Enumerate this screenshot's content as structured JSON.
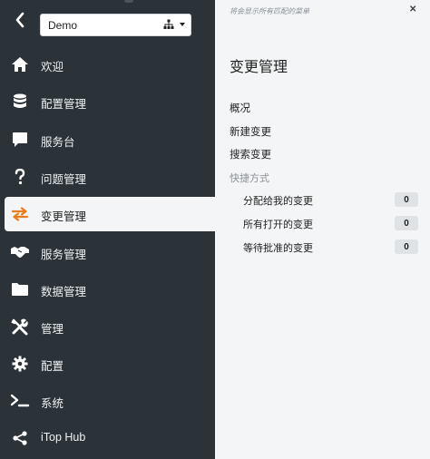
{
  "topbar": {
    "org_value": "Demo"
  },
  "menu": [
    {
      "label": "欢迎",
      "icon": "home-icon"
    },
    {
      "label": "配置管理",
      "icon": "database-icon"
    },
    {
      "label": "服务台",
      "icon": "chat-bubble-icon"
    },
    {
      "label": "问题管理",
      "icon": "question-mark-icon"
    },
    {
      "label": "变更管理",
      "icon": "exchange-arrows-icon",
      "active": true
    },
    {
      "label": "服务管理",
      "icon": "handshake-icon"
    },
    {
      "label": "数据管理",
      "icon": "folder-icon"
    },
    {
      "label": "管理",
      "icon": "tools-icon"
    },
    {
      "label": "配置",
      "icon": "gear-icon"
    },
    {
      "label": "系统",
      "icon": "terminal-icon"
    },
    {
      "label": "iTop Hub",
      "icon": "share-icon"
    }
  ],
  "panel": {
    "hint": "将会显示所有匹配的菜单",
    "title": "变更管理",
    "links": [
      "概况",
      "新建变更",
      "搜索变更"
    ],
    "shortcut_group": "快捷方式",
    "shortcuts": [
      {
        "label": "分配给我的变更",
        "count": "0"
      },
      {
        "label": "所有打开的变更",
        "count": "0"
      },
      {
        "label": "等待批准的变更",
        "count": "0"
      }
    ]
  },
  "colors": {
    "sidebar_bg": "#2b3338",
    "panel_bg": "#f4f5f7",
    "accent": "#ea7d1e"
  }
}
